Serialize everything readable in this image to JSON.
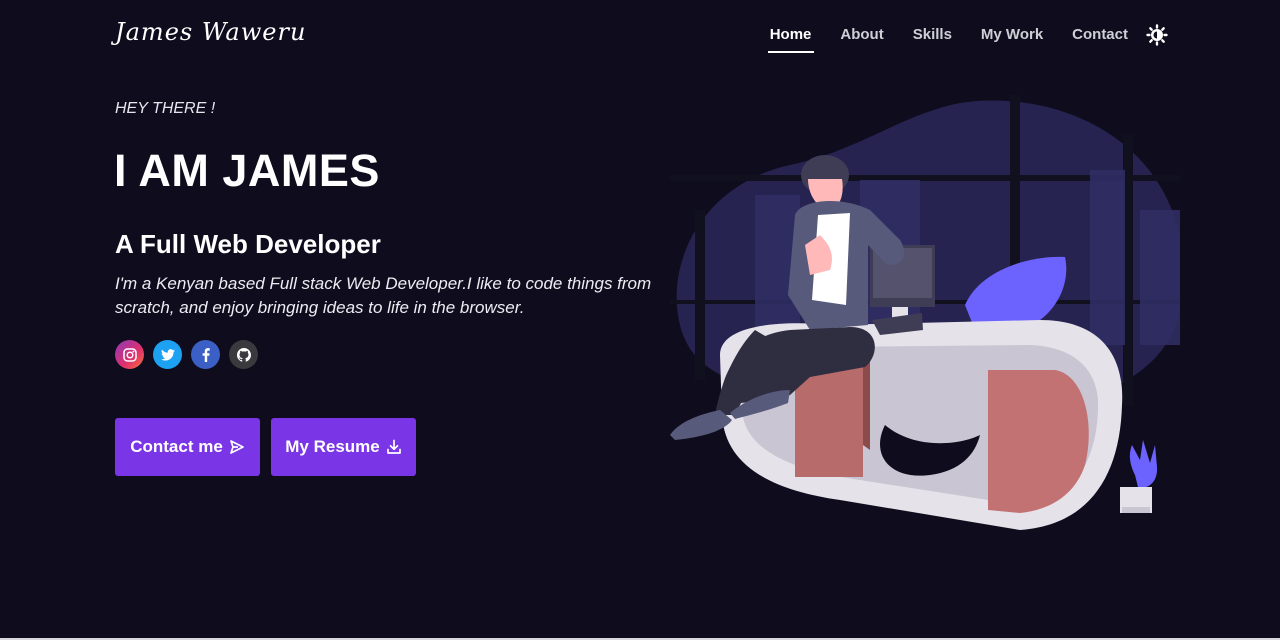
{
  "header": {
    "logo": "James Waweru",
    "nav": [
      {
        "label": "Home",
        "active": true
      },
      {
        "label": "About",
        "active": false
      },
      {
        "label": "Skills",
        "active": false
      },
      {
        "label": "My Work",
        "active": false
      },
      {
        "label": "Contact",
        "active": false
      }
    ],
    "theme_toggle_icon": "sun-icon"
  },
  "hero": {
    "greeting": "HEY THERE !",
    "title": "I AM JAMES",
    "subtitle": "A Full Web Developer",
    "description": "I'm a Kenyan based Full stack Web Developer.I like to code things from scratch, and enjoy bringing ideas to life in the browser."
  },
  "socials": [
    {
      "name": "instagram",
      "icon": "instagram-icon",
      "color": "#e1306c"
    },
    {
      "name": "twitter",
      "icon": "twitter-icon",
      "color": "#1da1f2"
    },
    {
      "name": "facebook",
      "icon": "facebook-icon",
      "color": "#3b5fc4"
    },
    {
      "name": "github",
      "icon": "github-icon",
      "color": "#3a3a3e"
    }
  ],
  "buttons": {
    "contact_label": "Contact me",
    "contact_icon": "send-icon",
    "resume_label": "My Resume",
    "resume_icon": "download-icon"
  },
  "colors": {
    "background": "#0f0d1d",
    "accent": "#7a35e6",
    "text": "#ffffff"
  },
  "illustration": "developer-desk-illustration"
}
